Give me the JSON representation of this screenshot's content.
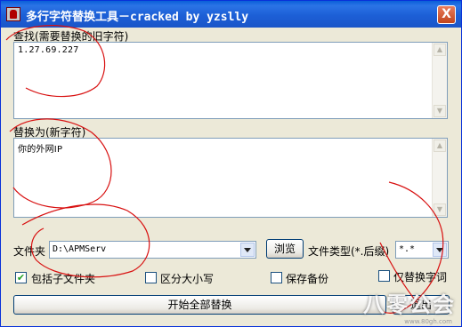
{
  "window": {
    "title": "多行字符替换工具－cracked by yzslly",
    "close_label": "X"
  },
  "find": {
    "label": "查找(需要替换的旧字符)",
    "value": "1.27.69.227"
  },
  "replace": {
    "label": "替换为(新字符)",
    "value": "你的外网IP"
  },
  "folder": {
    "label": "文件夹",
    "value": "D:\\APMServ",
    "browse_label": "浏览"
  },
  "filetype": {
    "label": "文件类型(*.后缀)",
    "value": "*.*"
  },
  "options": {
    "include_subfolders": {
      "label": "包括子文件夹",
      "checked": true
    },
    "case_sensitive": {
      "label": "区分大小写",
      "checked": false
    },
    "keep_backup": {
      "label": "保存备份",
      "checked": false
    },
    "whole_word": {
      "label": "仅替换字词",
      "checked": false
    }
  },
  "actions": {
    "replace_all_label": "开始全部替换",
    "exit_label": "退出"
  },
  "watermark": {
    "text": "八零公会",
    "url": "www.80gh.com"
  }
}
